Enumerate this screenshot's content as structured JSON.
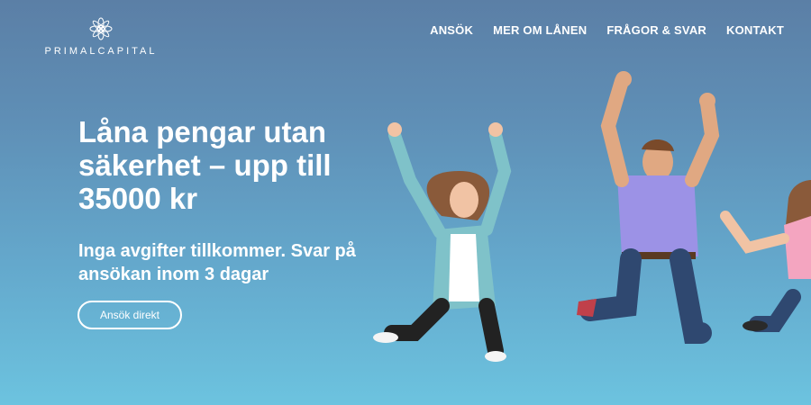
{
  "brand": {
    "logo_text": "PRIMALCAPITAL",
    "logo_icon": "starburst-icon"
  },
  "nav": {
    "items": [
      {
        "label": "ANSÖK"
      },
      {
        "label": "MER OM LÅNEN"
      },
      {
        "label": "FRÅGOR & SVAR"
      },
      {
        "label": "KONTAKT"
      }
    ]
  },
  "hero": {
    "headline": "Låna pengar utan säkerhet – upp till 35000 kr",
    "subline": "Inga avgifter tillkommer. Svar på ansökan inom 3 dagar",
    "cta_label": "Ansök direkt"
  },
  "colors": {
    "sky_top": "#5b7fa6",
    "sky_bottom": "#6cc3df",
    "text": "#ffffff"
  }
}
